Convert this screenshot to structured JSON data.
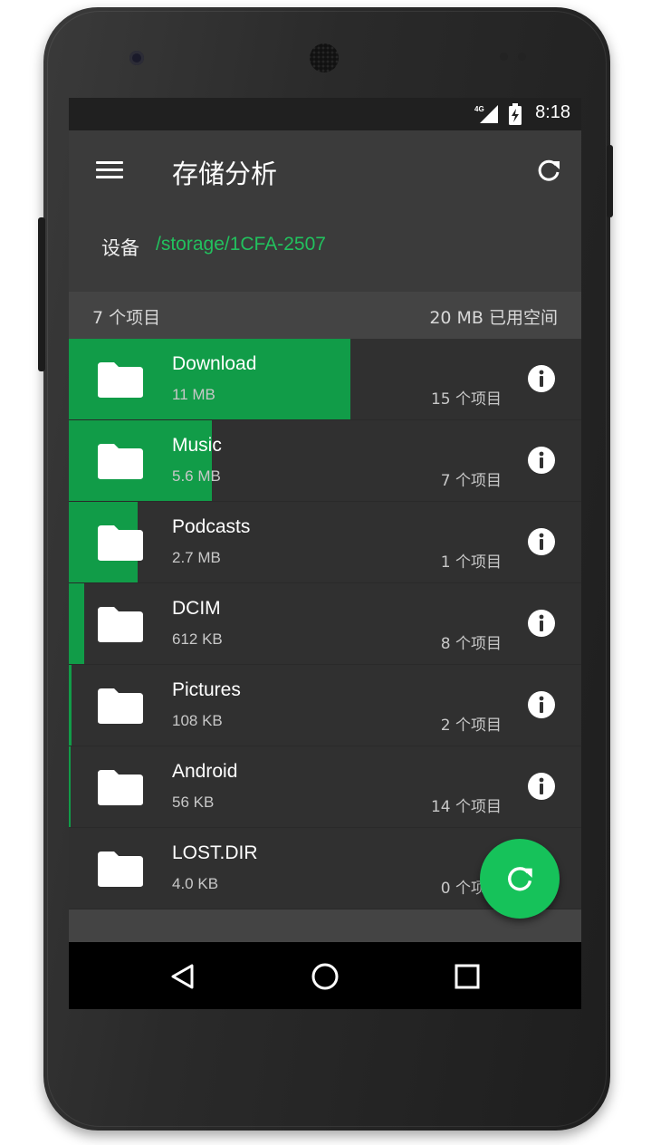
{
  "status_bar": {
    "network": "4G",
    "time": "8:18"
  },
  "app_bar": {
    "title": "存储分析",
    "menu_icon": "menu-icon",
    "refresh_icon": "refresh-icon"
  },
  "path": {
    "label": "设备",
    "value": "/storage/1CFA-2507"
  },
  "summary": {
    "count": "7 个项目",
    "used": "20 MB 已用空间"
  },
  "folders": [
    {
      "name": "Download",
      "size": "11 MB",
      "items": "15 个项目",
      "usage_fraction": 0.55
    },
    {
      "name": "Music",
      "size": "5.6 MB",
      "items": "7 个项目",
      "usage_fraction": 0.28
    },
    {
      "name": "Podcasts",
      "size": "2.7 MB",
      "items": "1 个项目",
      "usage_fraction": 0.134
    },
    {
      "name": "DCIM",
      "size": "612 KB",
      "items": "8 个项目",
      "usage_fraction": 0.03
    },
    {
      "name": "Pictures",
      "size": "108 KB",
      "items": "2 个项目",
      "usage_fraction": 0.005
    },
    {
      "name": "Android",
      "size": "56 KB",
      "items": "14 个项目",
      "usage_fraction": 0.003
    },
    {
      "name": "LOST.DIR",
      "size": "4.0 KB",
      "items": "0 个项目",
      "usage_fraction": 0.0
    }
  ],
  "colors": {
    "accent": "#16c25a",
    "usage_bar": "#119c48",
    "path_text": "#22c15e"
  },
  "nav": {
    "back_icon": "back-icon",
    "home_icon": "home-icon",
    "recents_icon": "recents-icon"
  }
}
